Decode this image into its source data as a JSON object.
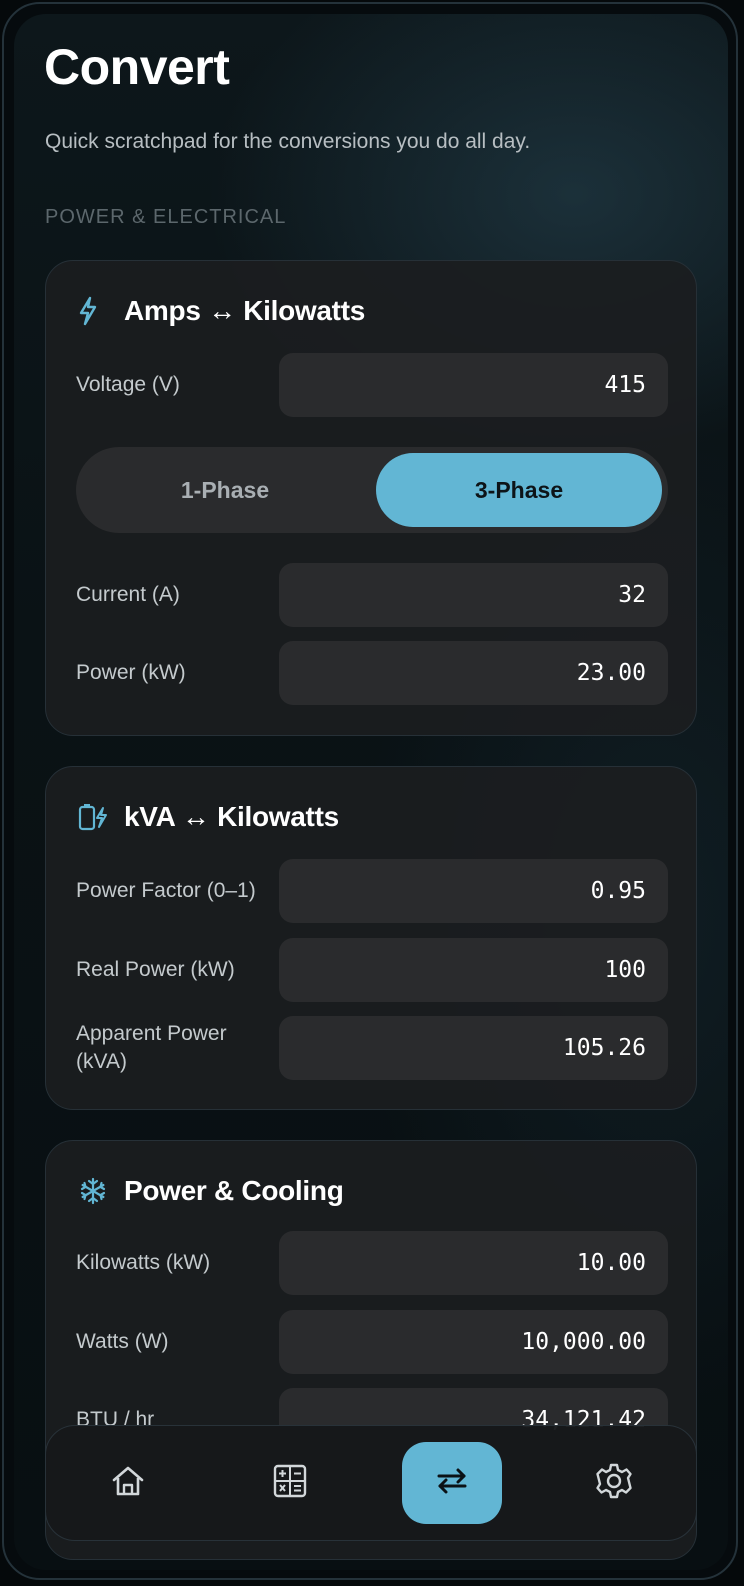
{
  "header": {
    "title": "Convert",
    "subtitle": "Quick scratchpad for the conversions you do all day."
  },
  "section_label": "POWER & ELECTRICAL",
  "cards": {
    "amps_kw": {
      "icon": "lightning-icon",
      "title": "Amps ↔ Kilowatts",
      "voltage": {
        "label": "Voltage (V)",
        "value": "415"
      },
      "phase": {
        "options": [
          "1-Phase",
          "3-Phase"
        ],
        "selected": "3-Phase"
      },
      "current": {
        "label": "Current (A)",
        "value": "32"
      },
      "power": {
        "label": "Power (kW)",
        "value": "23.00"
      }
    },
    "kva_kw": {
      "icon": "battery-charging-icon",
      "title": "kVA ↔ Kilowatts",
      "power_factor": {
        "label": "Power Factor (0–1)",
        "value": "0.95"
      },
      "real_power": {
        "label": "Real Power (kW)",
        "value": "100"
      },
      "apparent_power": {
        "label": "Apparent Power (kVA)",
        "value": "105.26"
      }
    },
    "cooling": {
      "icon": "snowflake-icon",
      "title": "Power & Cooling",
      "kilowatts": {
        "label": "Kilowatts (kW)",
        "value": "10.00"
      },
      "watts": {
        "label": "Watts (W)",
        "value": "10,000.00"
      },
      "btu": {
        "label": "BTU / hr",
        "value": "34,121.42"
      }
    }
  },
  "nav": {
    "items": [
      {
        "name": "home",
        "icon": "home-icon"
      },
      {
        "name": "calculator",
        "icon": "calculator-icon"
      },
      {
        "name": "convert",
        "icon": "swap-arrows-icon",
        "active": true
      },
      {
        "name": "settings",
        "icon": "gear-icon"
      }
    ]
  },
  "colors": {
    "accent": "#62b6d4",
    "background": "#0a1215",
    "card": "#1b1d1f",
    "field": "#2a2b2d"
  }
}
